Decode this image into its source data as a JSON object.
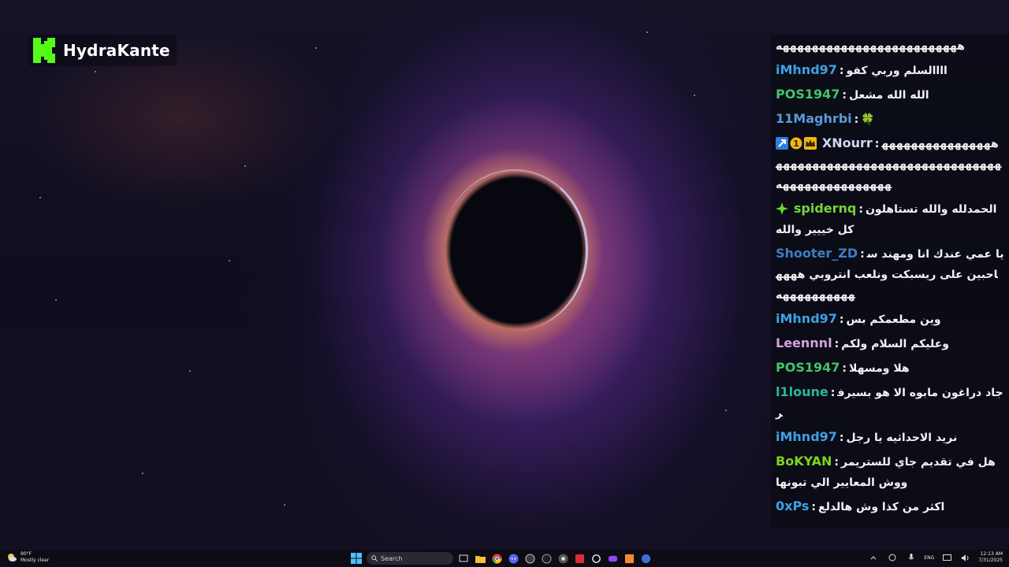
{
  "logo": {
    "brand": "HydraKante",
    "color": "#53fc18"
  },
  "chat": {
    "messages": [
      {
        "user": "",
        "text": "هههههههههههههههههههههههههه",
        "plain": true
      },
      {
        "user": "iMhnd97",
        "color": "#3ea1e6",
        "text": "اااالسلم وربي كفو"
      },
      {
        "user": "POS1947",
        "color": "#43c46b",
        "text": "الله الله مشعل"
      },
      {
        "user": "11Maghrbi",
        "color": "#5a9ad8",
        "text": "🍀"
      },
      {
        "user": "XNourr",
        "color": "#cfd8f0",
        "badges": [
          "arrow-badge-icon",
          "one-badge-icon",
          "crown-badge-icon"
        ],
        "text": "ههههههههههههههههههههههههههههههههههههههههههههههههههههههههههههههه"
      },
      {
        "user": "spidernq",
        "color": "#73d63a",
        "badges": [
          "diamond-badge-icon"
        ],
        "text": "الحمدلله والله تستاهلون كل خييير والله"
      },
      {
        "user": "Shooter_ZD",
        "color": "#3e7dc4",
        "text": "يا عمي عندك انا ومهند ساحبين على ريسبكت ونلعب انتروبي ههههههههههههههه"
      },
      {
        "user": "iMhnd97",
        "color": "#3ea1e6",
        "text": "وين مطعمكم بس"
      },
      {
        "user": "Leennnl",
        "color": "#d4a3e0",
        "text": "وعليكم السلام ولكم"
      },
      {
        "user": "POS1947",
        "color": "#43c46b",
        "text": "هلا ومسهلا"
      },
      {
        "user": "l1loune",
        "color": "#29b89a",
        "text": "جاد دراغون مابوه الا هو بسيرفر"
      },
      {
        "user": "iMhnd97",
        "color": "#3ea1e6",
        "text": "نريد الاحداثيه يا رجل"
      },
      {
        "user": "BoKYAN",
        "color": "#7ed320",
        "text": "هل في تقديم جاي للستريمر ووش المعايير الي تبونها"
      },
      {
        "user": "0xPs",
        "color": "#3ea1e6",
        "text": "اكثر من كذا وش هالدلع"
      }
    ],
    "separator": ":"
  },
  "taskbar": {
    "weather": {
      "temp": "90°F",
      "condition": "Mostly clear"
    },
    "search_placeholder": "Search",
    "apps": [
      "windows-start-icon",
      "task-view-icon",
      "file-explorer-icon",
      "chrome-icon",
      "discord-icon",
      "app-icon",
      "app-icon",
      "chrome-icon",
      "app-icon",
      "app-icon",
      "app-icon",
      "app-icon",
      "app-icon"
    ],
    "language": "ENG",
    "time": "12:13 AM",
    "date": "7/31/2025"
  }
}
